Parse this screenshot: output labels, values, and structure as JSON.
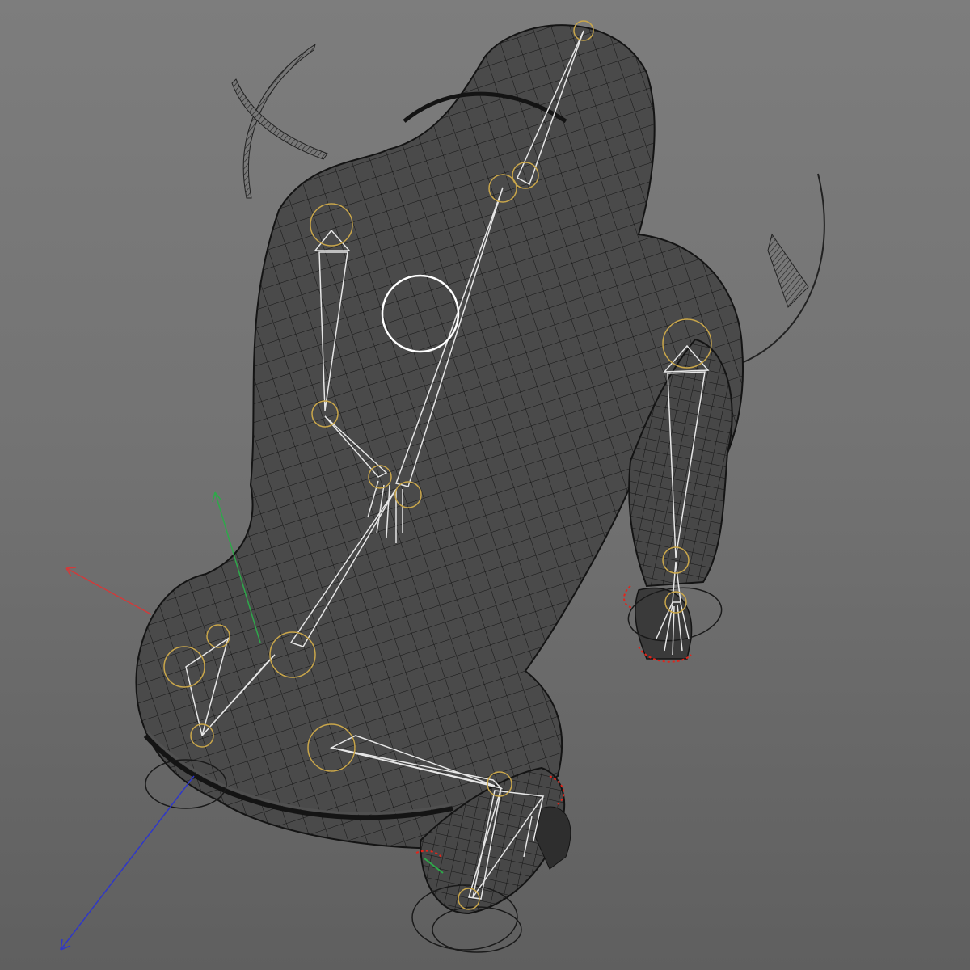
{
  "viewport": {
    "name": "3D viewport",
    "background_top": "#7d7d7d",
    "background_bottom": "#5f5f5f"
  },
  "model": {
    "fill": "#4a4a4a",
    "wire_color": "#141414",
    "skeleton_color": "#e6e6e6",
    "joint_ring_color": "#c9a64a",
    "selection_circle_color": "#ffffff",
    "ik_marker_color": "#e0261c"
  },
  "axes": {
    "x_color": "#d23a3a",
    "y_color": "#2ea84a",
    "z_color": "#2f37c8"
  }
}
